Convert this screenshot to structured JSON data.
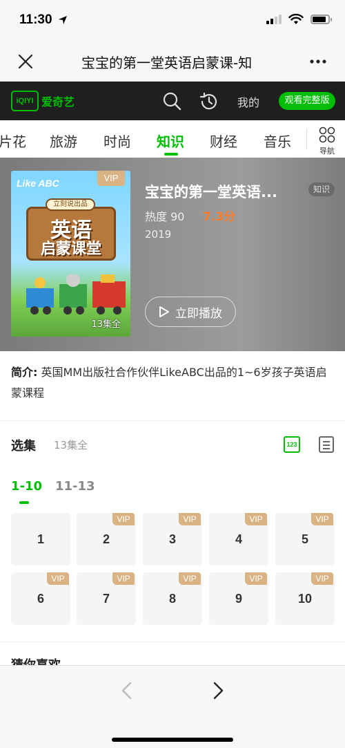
{
  "status_bar": {
    "time": "11:30",
    "battery_level": 0.85
  },
  "nav": {
    "title": "宝宝的第一堂英语启蒙课-知"
  },
  "header": {
    "logo": "iQIYI",
    "brand": "爱奇艺",
    "mine": "我的",
    "watch_full": "观看完整版"
  },
  "categories": {
    "items": [
      {
        "label": "片花"
      },
      {
        "label": "旅游"
      },
      {
        "label": "时尚"
      },
      {
        "label": "知识",
        "active": true
      },
      {
        "label": "财经"
      },
      {
        "label": "音乐"
      }
    ],
    "nav_label": "导航"
  },
  "hero": {
    "poster": {
      "vip": "VIP",
      "brand": "Like ABC",
      "sign_top": "立刻说出品",
      "line1": "英语",
      "line2": "启蒙课堂",
      "episodes": "13集全"
    },
    "title": "宝宝的第一堂英语...",
    "badge": "知识",
    "heat": "热度 90",
    "score": "7.3分",
    "year": "2019",
    "play": "立即播放"
  },
  "intro": {
    "label": "简介:",
    "text": "英国MM出版社合作伙伴LikeABC出品的1~6岁孩子英语启蒙课程"
  },
  "episodes": {
    "title": "选集",
    "count": "13集全",
    "grid_icon": "123",
    "ranges": [
      "1-10",
      "11-13"
    ],
    "items": [
      {
        "num": "1",
        "vip": ""
      },
      {
        "num": "2",
        "vip": "VIP"
      },
      {
        "num": "3",
        "vip": "VIP"
      },
      {
        "num": "4",
        "vip": "VIP"
      },
      {
        "num": "5",
        "vip": "VIP"
      },
      {
        "num": "6",
        "vip": "VIP"
      },
      {
        "num": "7",
        "vip": "VIP"
      },
      {
        "num": "8",
        "vip": "VIP"
      },
      {
        "num": "9",
        "vip": "VIP"
      },
      {
        "num": "10",
        "vip": "VIP"
      }
    ]
  },
  "recommend": {
    "title": "猜你喜欢"
  },
  "colors": {
    "accent": "#00be06",
    "vip": "#d9b383",
    "score": "#ff7d2a"
  }
}
